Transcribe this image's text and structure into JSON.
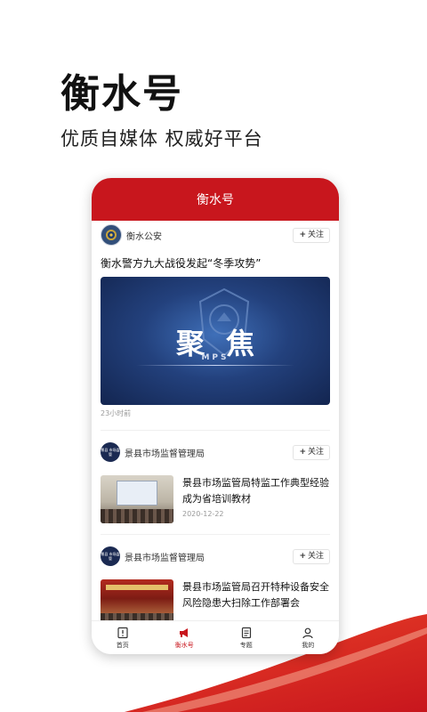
{
  "hero": {
    "title": "衡水号",
    "subtitle": "优质自媒体 权威好平台"
  },
  "phone": {
    "header_title": "衡水号",
    "feed": [
      {
        "source": "衡水公安",
        "follow_label": "关注",
        "title": "衡水警方九大战役发起“冬季攻势”",
        "banner_text": "聚焦",
        "banner_sub": "MPS",
        "time": "23小时前"
      },
      {
        "source": "景县市场监督管理局",
        "avatar_text": "景县 市场监管",
        "follow_label": "关注",
        "title": "景县市场监管局特监工作典型经验成为省培训教材",
        "date": "2020-12-22"
      },
      {
        "source": "景县市场监督管理局",
        "avatar_text": "景县 市场监管",
        "follow_label": "关注",
        "title": "景县市场监管局召开特种设备安全风险隐患大扫除工作部署会"
      }
    ],
    "tabs": [
      {
        "label": "首页",
        "icon": "home-icon"
      },
      {
        "label": "衡水号",
        "icon": "megaphone-icon",
        "active": true
      },
      {
        "label": "专题",
        "icon": "topic-icon"
      },
      {
        "label": "我的",
        "icon": "user-icon"
      }
    ]
  },
  "colors": {
    "brand_red": "#c8161d",
    "swoosh_red": "#e0281a"
  }
}
